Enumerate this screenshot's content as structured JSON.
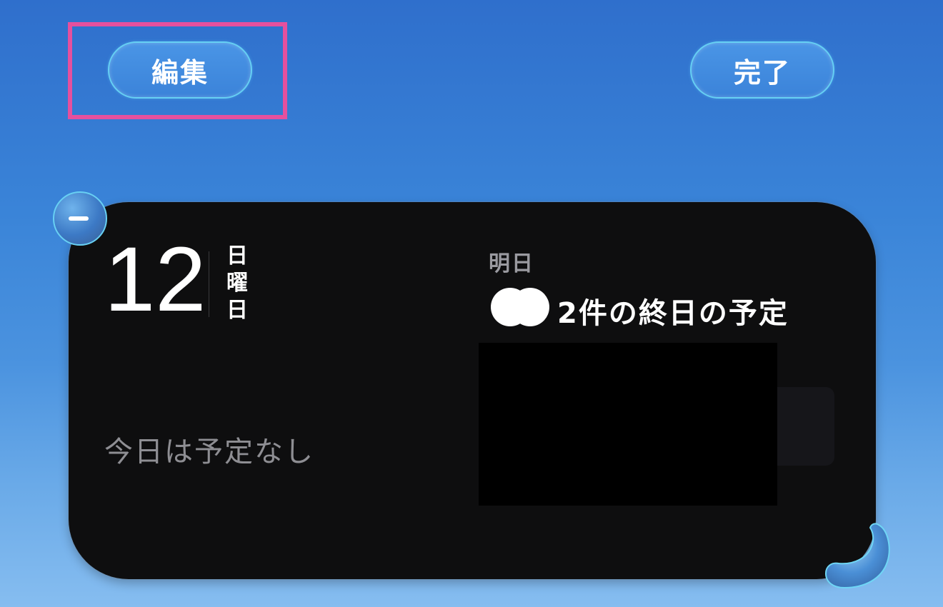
{
  "header": {
    "edit_label": "編集",
    "done_label": "完了"
  },
  "widget": {
    "date_number": "12",
    "weekday_chars": [
      "日",
      "曜",
      "日"
    ],
    "today_status": "今日は予定なし",
    "tomorrow_label": "明日",
    "tomorrow_events": "2件の終日の予定"
  },
  "colors": {
    "highlight": "#e5509e",
    "widget_bg": "#0e0e0f",
    "pill_border": "#66d0f3"
  }
}
